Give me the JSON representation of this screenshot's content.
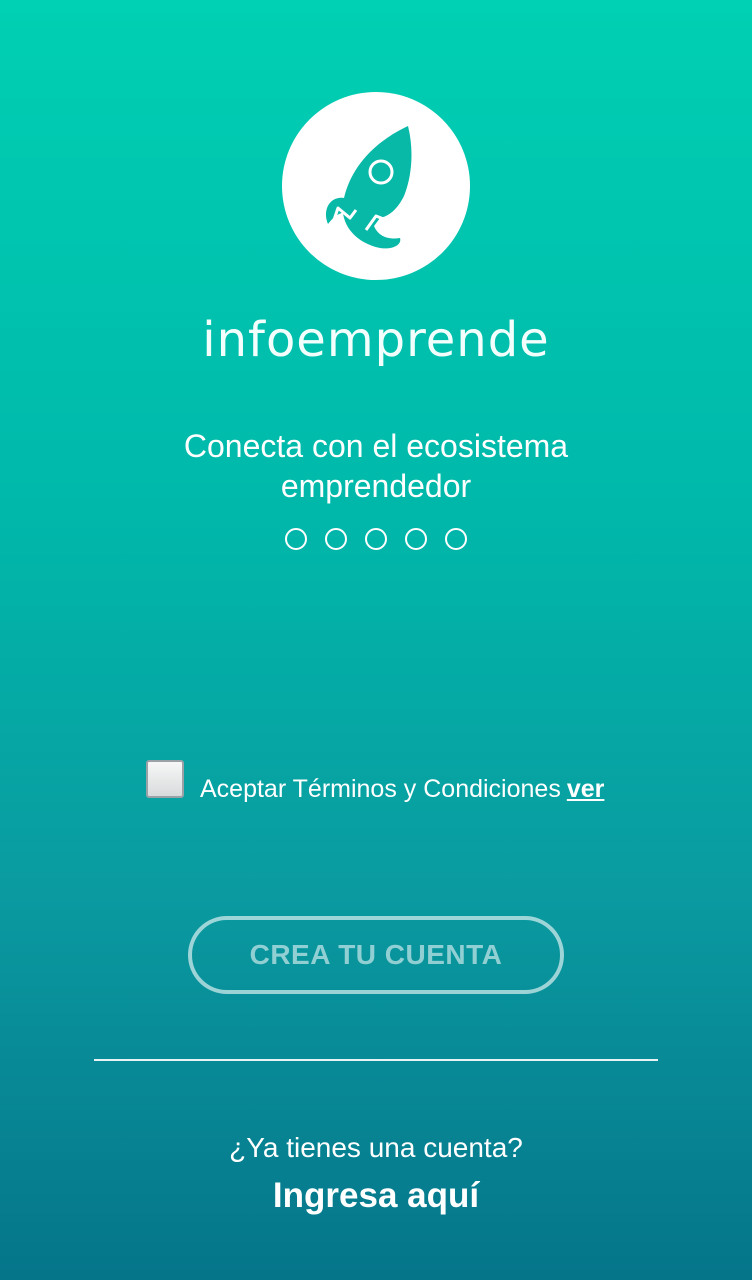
{
  "brand": {
    "logo_icon": "rocket-icon",
    "name": "infoemprende"
  },
  "tagline": "Conecta con el ecosistema emprendedor",
  "pager": {
    "total": 5,
    "active": 0
  },
  "terms": {
    "checked": false,
    "label": "Aceptar Términos y Condiciones",
    "link": "ver"
  },
  "create_account": {
    "label": "CREA TU CUENTA"
  },
  "login": {
    "prompt": "¿Ya tienes una cuenta?",
    "link": "Ingresa aquí"
  },
  "colors": {
    "gradient_top": "#00d0b3",
    "gradient_bottom": "#05758a",
    "text": "#ffffff"
  }
}
